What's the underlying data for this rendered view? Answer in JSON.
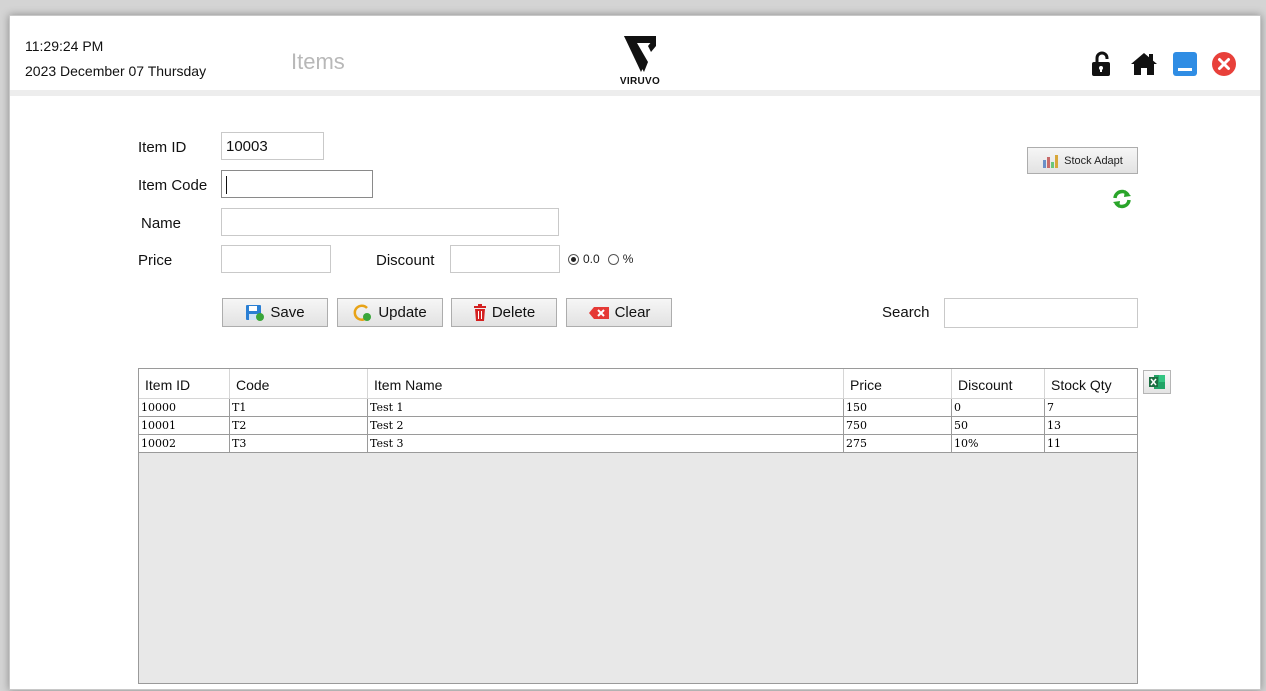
{
  "header": {
    "time": "11:29:24 PM",
    "date": "2023  December  07 Thursday",
    "page_title": "Items",
    "logo_text": "VIRUVO",
    "icons": [
      "lock-open-icon",
      "home-icon",
      "minimize-icon",
      "close-icon"
    ]
  },
  "form": {
    "item_id_label": "Item ID",
    "item_id_value": "10003",
    "item_code_label": "Item Code",
    "item_code_value": "",
    "name_label": "Name",
    "name_value": "",
    "price_label": "Price",
    "price_value": "",
    "discount_label": "Discount",
    "discount_value": "",
    "discount_mode_options": [
      "0.0",
      "%"
    ],
    "discount_mode_selected": "0.0",
    "search_label": "Search",
    "search_value": ""
  },
  "buttons": {
    "save": "Save",
    "update": "Update",
    "delete": "Delete",
    "clear": "Clear",
    "stock_adapt": "Stock Adapt"
  },
  "table": {
    "columns": [
      "Item ID",
      "Code",
      "Item Name",
      "Price",
      "Discount",
      "Stock Qty"
    ],
    "rows": [
      [
        "10000",
        "T1",
        "Test 1",
        "150",
        "0",
        "7"
      ],
      [
        "10001",
        "T2",
        "Test 2",
        "750",
        "50",
        "13"
      ],
      [
        "10002",
        "T3",
        "Test 3",
        "275",
        "10%",
        "11"
      ]
    ]
  },
  "colors": {
    "close": "#e8403a",
    "minimize": "#2f8de4",
    "refresh": "#2aa52a",
    "delete": "#d42020",
    "clear": "#e53935",
    "excel": "#1d6f42"
  }
}
